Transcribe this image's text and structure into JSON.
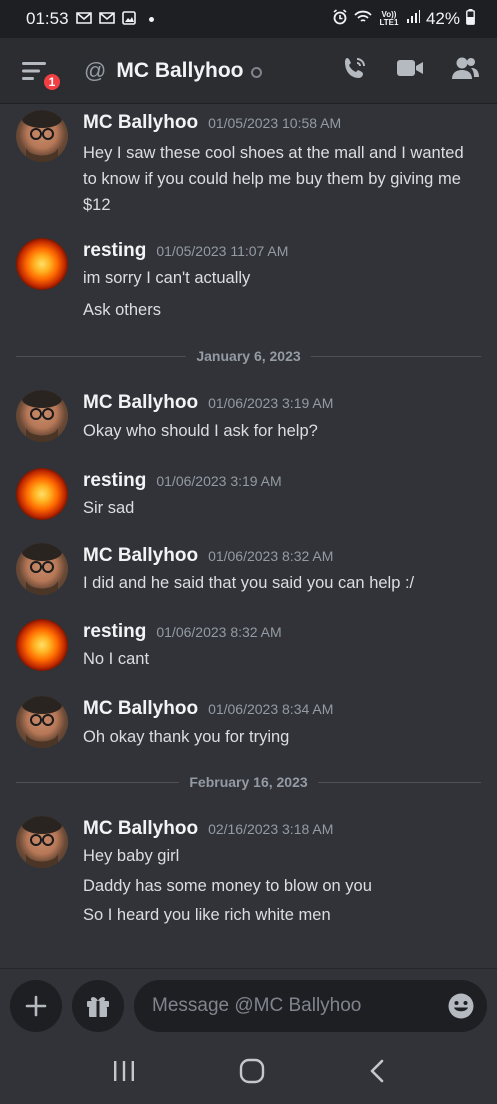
{
  "status_bar": {
    "time": "01:53",
    "notif_icons": [
      "gmail-icon",
      "gmail-icon",
      "image-icon"
    ],
    "volte": "Vo)) LTE1",
    "battery": "42%"
  },
  "header": {
    "badge_count": "1",
    "at_symbol": "@",
    "title": "MC Ballyhoo",
    "actions": [
      "voice-call-icon",
      "video-call-icon",
      "members-icon"
    ]
  },
  "messages": [
    {
      "author": "MC Ballyhoo",
      "timestamp": "01/05/2023 10:58 AM",
      "avatar": "face",
      "lines": [
        "Hey I saw these cool shoes at the mall and I wanted",
        "to know if you could help me buy them by giving me",
        "$12"
      ]
    },
    {
      "author": "resting",
      "timestamp": "01/05/2023 11:07 AM",
      "avatar": "sun",
      "lines": [
        "im sorry I can't actually",
        "Ask others"
      ]
    },
    {
      "divider": "January 6, 2023"
    },
    {
      "author": "MC Ballyhoo",
      "timestamp": "01/06/2023 3:19 AM",
      "avatar": "face",
      "lines": [
        "Okay who should I ask for help?"
      ]
    },
    {
      "author": "resting",
      "timestamp": "01/06/2023 3:19 AM",
      "avatar": "sun",
      "lines": [
        "Sir sad"
      ]
    },
    {
      "author": "MC Ballyhoo",
      "timestamp": "01/06/2023 8:32 AM",
      "avatar": "face",
      "lines": [
        "I did and he said that you said you can help :/"
      ]
    },
    {
      "author": "resting",
      "timestamp": "01/06/2023 8:32 AM",
      "avatar": "sun",
      "lines": [
        "No I cant"
      ]
    },
    {
      "author": "MC Ballyhoo",
      "timestamp": "01/06/2023 8:34 AM",
      "avatar": "face",
      "lines": [
        "Oh okay thank you for trying"
      ]
    },
    {
      "divider": "February 16, 2023"
    },
    {
      "author": "MC Ballyhoo",
      "timestamp": "02/16/2023 3:18 AM",
      "avatar": "face",
      "lines": [
        "Hey baby girl",
        "Daddy has some money to blow on you",
        "So I heard you like rich white men"
      ]
    }
  ],
  "composer": {
    "placeholder": "Message @MC Ballyhoo"
  },
  "nav_bar": [
    "recent-apps-icon",
    "home-icon",
    "back-icon"
  ],
  "colors": {
    "background": "#313338",
    "header": "#2b2d31",
    "input": "#1e1f22",
    "badge": "#f23f43",
    "muted": "#949ba4"
  }
}
